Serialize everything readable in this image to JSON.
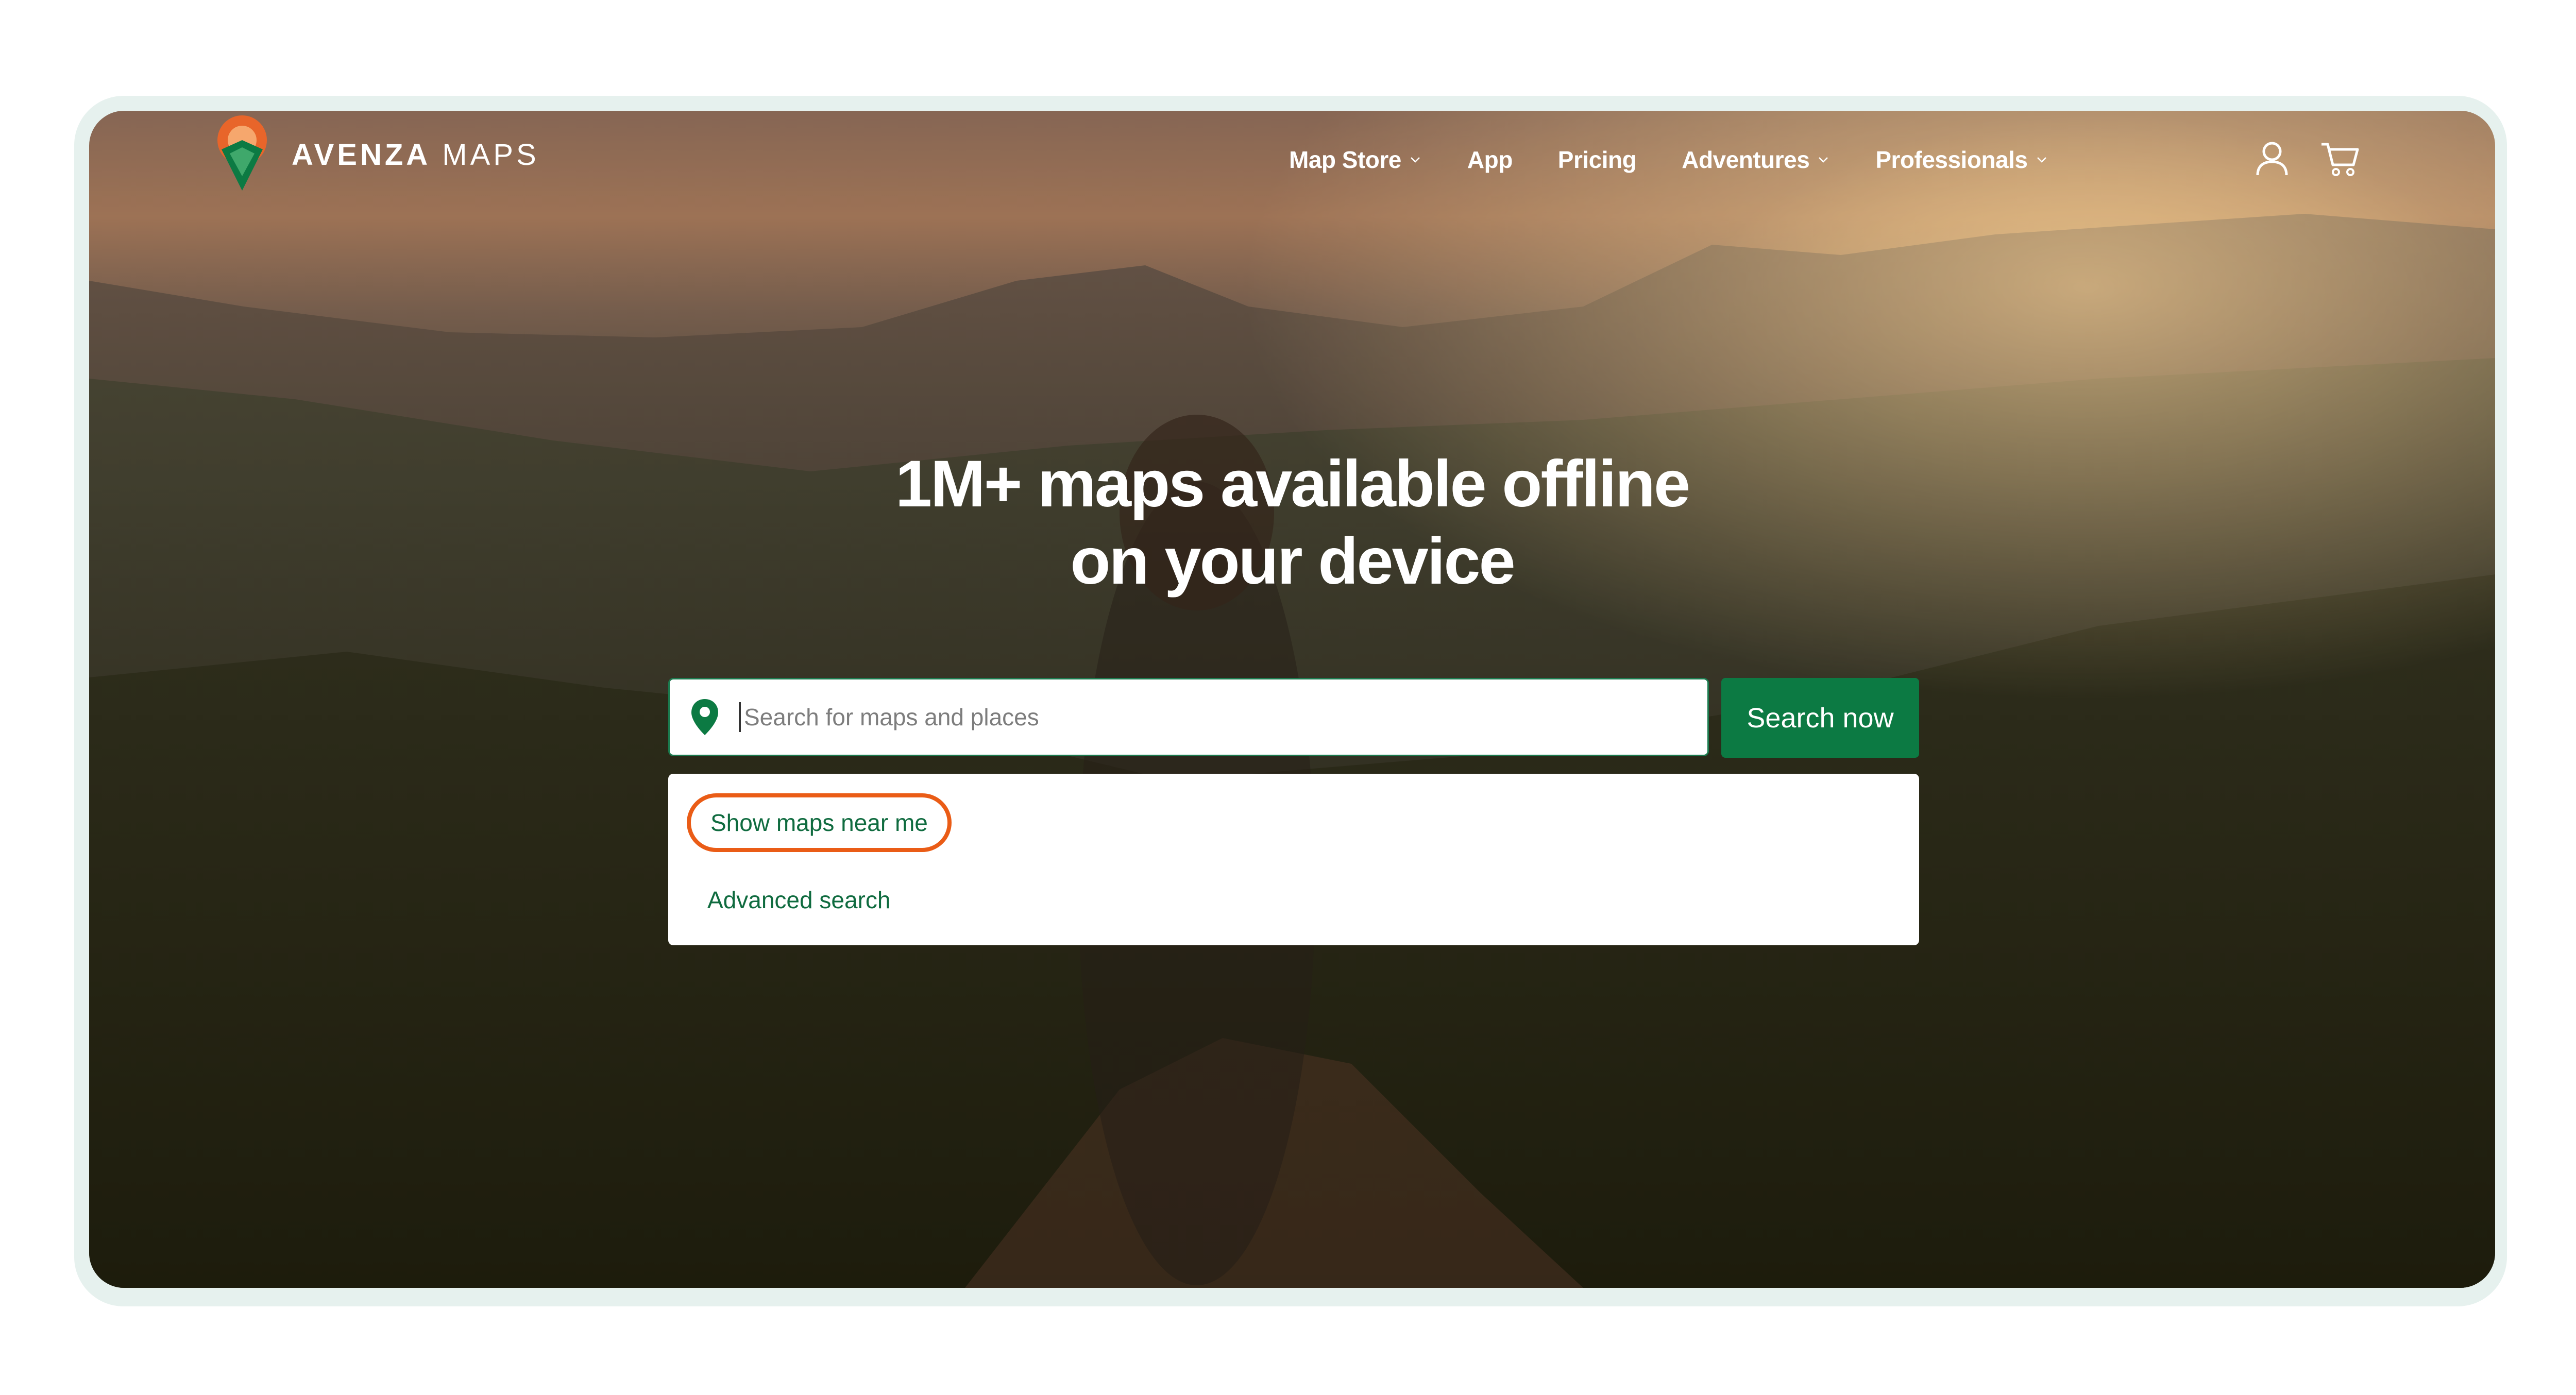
{
  "brand": {
    "name_bold": "AVENZA",
    "name_light": "MAPS"
  },
  "nav": {
    "items": [
      {
        "label": "Map Store",
        "has_dropdown": true
      },
      {
        "label": "App",
        "has_dropdown": false
      },
      {
        "label": "Pricing",
        "has_dropdown": false
      },
      {
        "label": "Adventures",
        "has_dropdown": true
      },
      {
        "label": "Professionals",
        "has_dropdown": true
      }
    ],
    "icons": [
      "user-icon",
      "cart-icon"
    ]
  },
  "hero": {
    "headline_line1": "1M+ maps available offline",
    "headline_line2": "on your device"
  },
  "search": {
    "placeholder": "Search for maps and places",
    "value": "",
    "button_label": "Search now",
    "icon": "location-pin-icon"
  },
  "dropdown": {
    "near_me_label": "Show maps near me",
    "advanced_label": "Advanced search"
  },
  "colors": {
    "accent_green": "#0c7a43",
    "highlight_orange": "#ea5c16",
    "frame": "#e6f1ee"
  }
}
